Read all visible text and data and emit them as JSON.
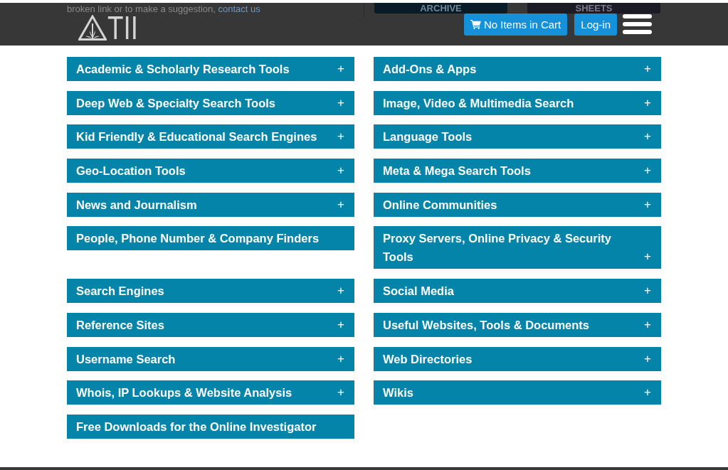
{
  "behind_header": {
    "note": "broken link or to make a suggestion,",
    "link": "contact us",
    "buttons": [
      "ARCHIVE",
      "SHEETS"
    ]
  },
  "header": {
    "logo_text": "TII",
    "cart_button": "No Items in Cart",
    "login_button": "Log-in"
  },
  "categories": [
    {
      "label": "Academic & Scholarly Research Tools",
      "toggle": "+"
    },
    {
      "label": "Add-Ons & Apps",
      "toggle": "+"
    },
    {
      "label": "Deep Web & Specialty Search Tools",
      "toggle": "+"
    },
    {
      "label": "Image, Video & Multimedia Search",
      "toggle": "+"
    },
    {
      "label": "Kid Friendly & Educational Search Engines",
      "toggle": "+"
    },
    {
      "label": "Language Tools",
      "toggle": "+"
    },
    {
      "label": "Geo-Location Tools",
      "toggle": "+"
    },
    {
      "label": "Meta & Mega Search Tools",
      "toggle": "+"
    },
    {
      "label": "News and Journalism",
      "toggle": "+"
    },
    {
      "label": "Online Communities",
      "toggle": "+"
    },
    {
      "label": "People, Phone Number & Company Finders"
    },
    {
      "label": "Proxy Servers, Online Privacy & Security Tools",
      "toggle": "+"
    },
    {
      "label": "Search Engines",
      "toggle": "+"
    },
    {
      "label": "Social Media",
      "toggle": "+"
    },
    {
      "label": "Reference Sites",
      "toggle": "+"
    },
    {
      "label": "Useful Websites, Tools & Documents",
      "toggle": "+"
    },
    {
      "label": "Username Search",
      "toggle": "+"
    },
    {
      "label": "Web Directories",
      "toggle": "+"
    },
    {
      "label": "Whois, IP Lookups & Website Analysis",
      "toggle": "+"
    },
    {
      "label": "Wikis",
      "toggle": "+"
    },
    {
      "label": "Free Downloads for the Online Investigator"
    }
  ]
}
